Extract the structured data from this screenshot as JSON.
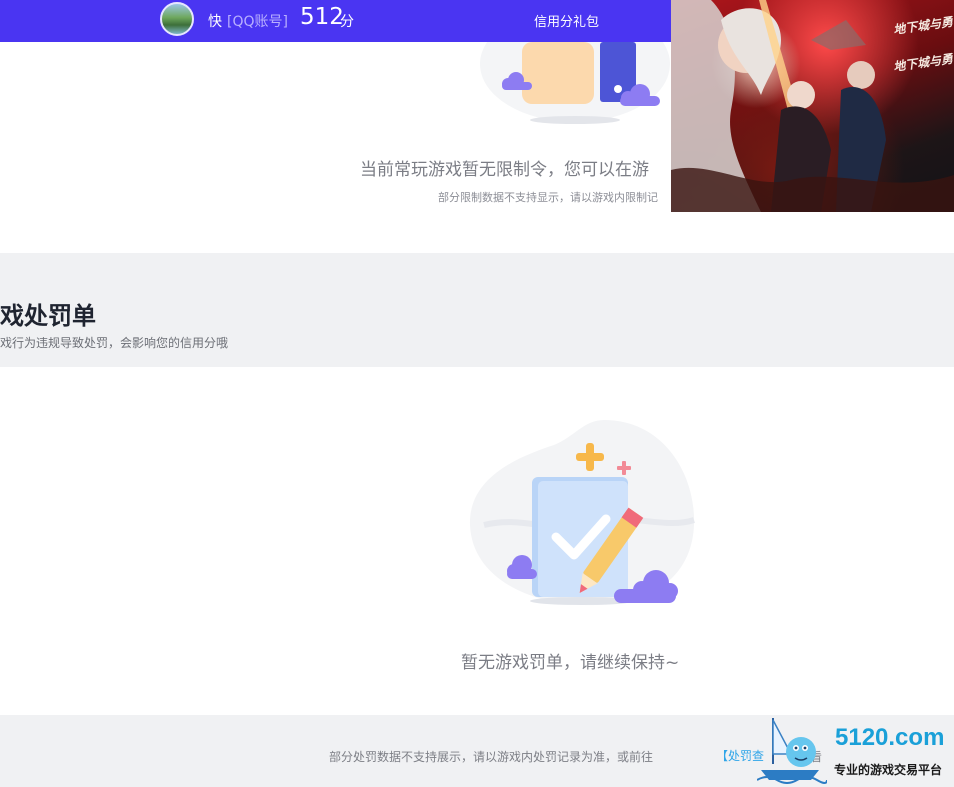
{
  "header": {
    "nickname": "快",
    "account_type": "[QQ账号]",
    "score": "512",
    "score_unit": "分",
    "gift_link": "信用分礼包"
  },
  "restrictions": {
    "empty_message": "当前常玩游戏暂无限制令，您可以在游",
    "note": "部分限制数据不支持显示，请以游戏内限制记"
  },
  "penalties": {
    "title": "戏处罚单",
    "subtitle": "戏行为违规导致处罚，会影响您的信用分哦",
    "empty_message": "暂无游戏罚单，请继续保持~"
  },
  "footer": {
    "note": "部分处罚数据不支持展示，请以游戏内处罚记录为准，或前往",
    "link": "【处罚查",
    "tail": "看"
  },
  "banner": {
    "logo": "地下城与勇士"
  },
  "watermark": {
    "domain": "5120.com",
    "tagline": "专业的游戏交易平台"
  },
  "colors": {
    "topbar": "#4a35f2",
    "section_bg": "#f0f1f3",
    "link": "#2fa5e8",
    "watermark": "#1aa0d8"
  }
}
